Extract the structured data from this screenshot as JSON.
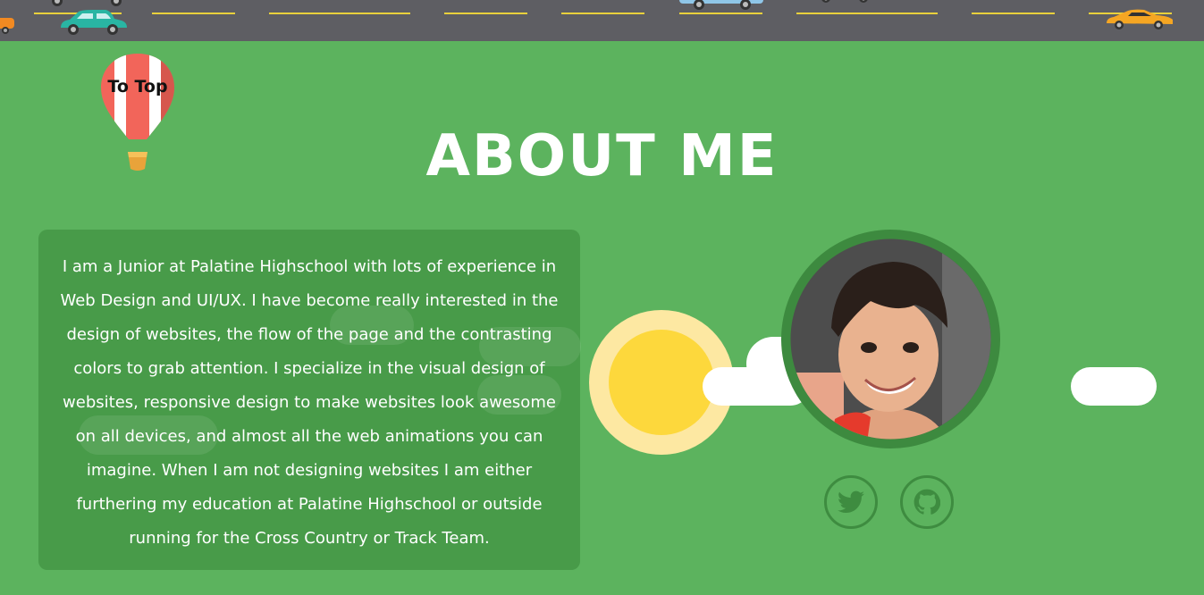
{
  "to_top_label": "To Top",
  "section_title": "ABOUT ME",
  "about_text": "I am a Junior at Palatine Highschool with lots of experience in Web Design and UI/UX. I have become really interested in the design of websites, the flow of the page and the contrasting colors to grab attention. I specialize in the visual design of websites, responsive design to make websites look awesome on all devices, and almost all the web animations you can imagine. When I am not designing websites I am either furthering my education at Palatine Highschool or outside running for the Cross Country or Track Team.",
  "social": {
    "twitter_icon": "twitter-icon",
    "github_icon": "github-icon"
  },
  "colors": {
    "background": "#5cb35e",
    "card": "#489b49",
    "road": "#5e5e63",
    "lane": "#e9d13c",
    "accent_dark": "#3e8c40",
    "sun": "#fdd83c",
    "sun_glow": "#fde8a2"
  }
}
